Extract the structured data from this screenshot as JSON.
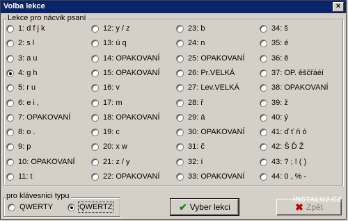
{
  "window": {
    "title": "Volba lekce",
    "close_glyph": "×"
  },
  "lessons_group": {
    "legend": "Lekce pro nácvik psaní"
  },
  "lessons": [
    [
      {
        "label": "1: d f j k",
        "checked": false
      },
      {
        "label": "2: s l",
        "checked": false
      },
      {
        "label": "3: a u",
        "checked": false
      },
      {
        "label": "4: g h",
        "checked": true
      },
      {
        "label": "5: r u",
        "checked": false
      },
      {
        "label": "6: e i ,",
        "checked": false
      },
      {
        "label": "7: OPAKOVANÍ",
        "checked": false
      },
      {
        "label": "8: o .",
        "checked": false
      },
      {
        "label": "9: p",
        "checked": false
      },
      {
        "label": "10: OPAKOVANÍ",
        "checked": false
      },
      {
        "label": "11: t",
        "checked": false
      }
    ],
    [
      {
        "label": "12: y / z",
        "checked": false
      },
      {
        "label": "13: ú q",
        "checked": false
      },
      {
        "label": "14: OPAKOVANÍ",
        "checked": false
      },
      {
        "label": "15: OPAKOVANÍ",
        "checked": false
      },
      {
        "label": "16: v",
        "checked": false
      },
      {
        "label": "17: m",
        "checked": false
      },
      {
        "label": "18: OPAKOVANÍ",
        "checked": false
      },
      {
        "label": "19: c",
        "checked": false
      },
      {
        "label": "20: x w",
        "checked": false
      },
      {
        "label": "21: z / y",
        "checked": false
      },
      {
        "label": "22: OPAKOVANÍ",
        "checked": false
      }
    ],
    [
      {
        "label": "23: b",
        "checked": false
      },
      {
        "label": "24: n",
        "checked": false
      },
      {
        "label": "25: OPAKOVANÍ",
        "checked": false
      },
      {
        "label": "26: Pr.VELKÁ",
        "checked": false
      },
      {
        "label": "27: Lev.VELKÁ",
        "checked": false
      },
      {
        "label": "28: ř",
        "checked": false
      },
      {
        "label": "29: á",
        "checked": false
      },
      {
        "label": "30: OPAKOVANÍ",
        "checked": false
      },
      {
        "label": "31: č",
        "checked": false
      },
      {
        "label": "32: í",
        "checked": false
      },
      {
        "label": "33: OPAKOVANÍ",
        "checked": false
      }
    ],
    [
      {
        "label": "34: š",
        "checked": false
      },
      {
        "label": "35: é",
        "checked": false
      },
      {
        "label": "36: ě",
        "checked": false
      },
      {
        "label": "37: OP. ěščřáéí",
        "checked": false
      },
      {
        "label": "38: OPAKOVANÍ",
        "checked": false
      },
      {
        "label": "39: ž",
        "checked": false
      },
      {
        "label": "40: ý",
        "checked": false
      },
      {
        "label": "41: ď ť ň ó",
        "checked": false
      },
      {
        "label": "42: Š Ď Ž",
        "checked": false
      },
      {
        "label": "43: ? ; ! ( )",
        "checked": false
      },
      {
        "label": "44: 0 , % -",
        "checked": false
      }
    ]
  ],
  "keyboard_group": {
    "legend": "pro klávesnici typu",
    "options": [
      {
        "label": "QWERTY",
        "checked": false
      },
      {
        "label": "QWERTZ",
        "checked": true
      }
    ]
  },
  "buttons": {
    "select": {
      "label": "Vyber lekci",
      "icon": "check-icon"
    },
    "back": {
      "label": "Zpět",
      "icon": "x-icon"
    }
  },
  "watermark": "INSTALUJ.CZ"
}
